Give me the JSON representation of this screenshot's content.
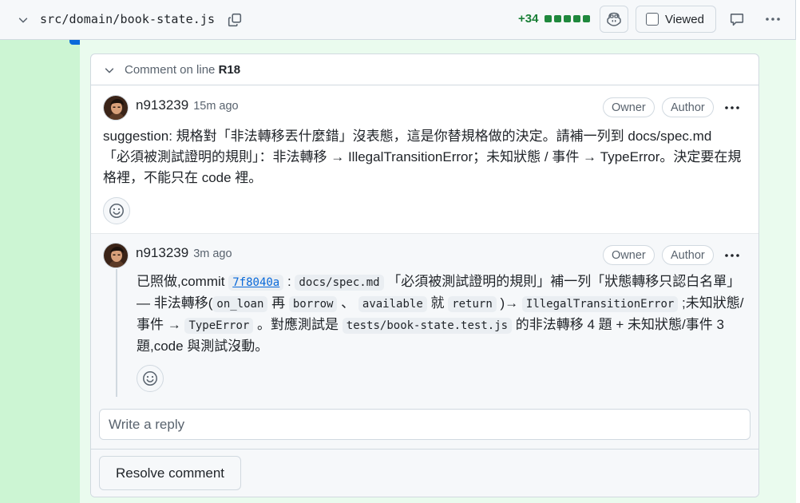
{
  "file_header": {
    "path": "src/domain/book-state.js",
    "additions": "+34",
    "viewed_label": "Viewed",
    "diffstat_color": "#1f883d"
  },
  "thread": {
    "title_prefix": "Comment on line",
    "line_ref": "R18",
    "comments": [
      {
        "author": "n913239",
        "time": "15m ago",
        "badges": [
          "Owner",
          "Author"
        ],
        "body": "suggestion: 規格對「非法轉移丟什麼錯」沒表態，這是你替規格做的決定。請補一列到 docs/spec.md 「必須被測試證明的規則」：非法轉移 → IllegalTransitionError；未知狀態 / 事件 → TypeError。決定要在規格裡，不能只在 code 裡。"
      },
      {
        "author": "n913239",
        "time": "3m ago",
        "badges": [
          "Owner",
          "Author"
        ],
        "body_parts": {
          "t1": "已照做,commit ",
          "sha": "7f8040a",
          "t2": " : ",
          "c1": "docs/spec.md",
          "t3": " 「必須被測試證明的規則」補一列「狀態轉移只認白名單」— 非法轉移(",
          "c2": "on_loan",
          "t4": " 再 ",
          "c3": "borrow",
          "t5": " 、 ",
          "c4": "available",
          "t6": " 就 ",
          "c5": "return",
          "t7": " )→ ",
          "c6": "IllegalTransitionError",
          "t8": " ;未知狀態/事件 → ",
          "c7": "TypeError",
          "t9": " 。對應測試是 ",
          "c8": "tests/book-state.test.js",
          "t10": " 的非法轉移 4 題 + 未知狀態/事件 3 題,code 與測試沒動。"
        }
      }
    ],
    "reply_placeholder": "Write a reply",
    "resolve_label": "Resolve comment"
  }
}
